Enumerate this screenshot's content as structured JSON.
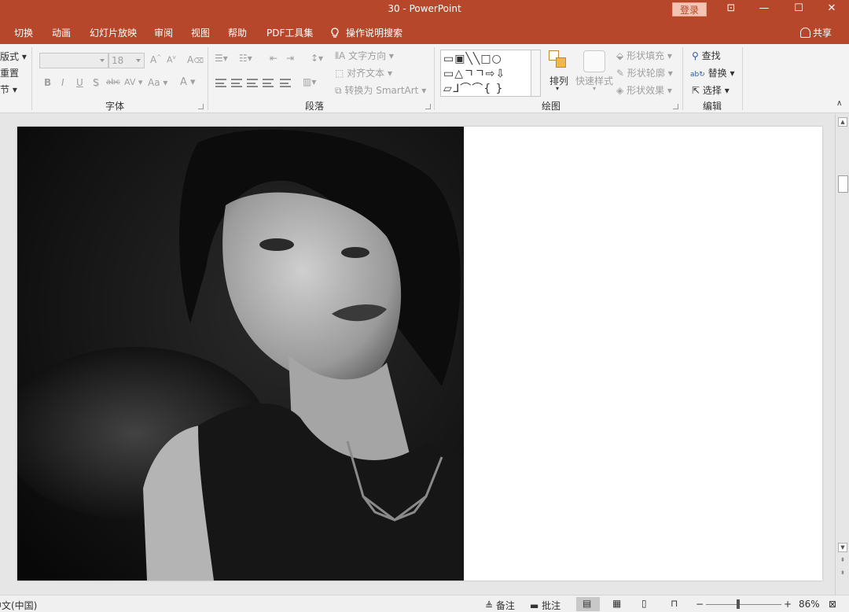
{
  "window": {
    "title": "30  -  PowerPoint",
    "login_label": "登录",
    "ribbon_display_glyph": "⊡",
    "minimize_glyph": "—",
    "maximize_glyph": "☐",
    "close_glyph": "✕"
  },
  "menu": {
    "items": [
      "切换",
      "动画",
      "幻灯片放映",
      "审阅",
      "视图",
      "帮助",
      "PDF工具集"
    ],
    "tell_me": "操作说明搜索",
    "share": "共享"
  },
  "ribbon": {
    "slides": {
      "layout": "版式",
      "reset": "重置",
      "section": "节"
    },
    "font": {
      "label": "字体",
      "size_value": "18",
      "grow": "A",
      "shrink": "A",
      "clear": "A",
      "bold": "B",
      "italic": "I",
      "underline": "U",
      "shadow": "S",
      "strike": "abc",
      "spacing": "AV",
      "change_case": "Aa",
      "color": "A"
    },
    "paragraph": {
      "label": "段落",
      "text_direction": "文字方向",
      "align_text": "对齐文本",
      "convert_smartart": "转换为 SmartArt"
    },
    "drawing": {
      "label": "绘图",
      "shapes_row1": "▭▣╲╲□○",
      "shapes_row2": "▭△ㄱㄱ⇨⇩",
      "shapes_row3": "▱ᒧ⌒⌒{ }",
      "arrange": "排列",
      "quick_styles": "快速样式",
      "shape_fill": "形状填充",
      "shape_outline": "形状轮廓",
      "shape_effects": "形状效果"
    },
    "editing": {
      "label": "编辑",
      "find": "查找",
      "replace": "替换",
      "select": "选择"
    }
  },
  "status": {
    "language": "中文(中国)",
    "notes": "备注",
    "comments": "批注",
    "zoom_minus": "−",
    "zoom_plus": "+",
    "zoom": "86%"
  },
  "colors": {
    "accent": "#b7472a",
    "ribbon_bg": "#f3f3f3",
    "canvas_bg": "#e6e6e6"
  }
}
